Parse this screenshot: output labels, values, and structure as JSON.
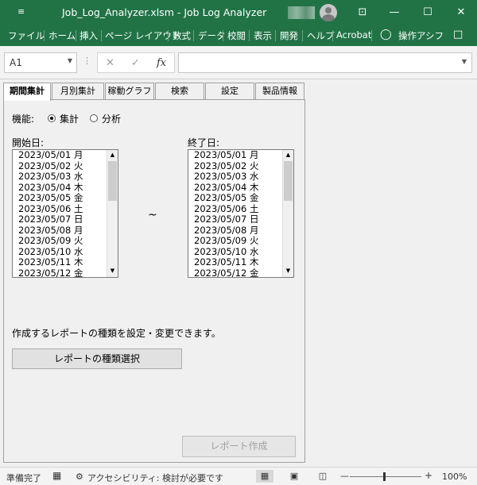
{
  "titlebar": {
    "qat_icon": "customize-qat-icon",
    "title": "Job_Log_Analyzer.xlsm  -  Job Log Analyzer",
    "minimize": "—",
    "maximize": "☐",
    "close": "✕",
    "ribbon_display": "⊡"
  },
  "ribbon": {
    "tabs": [
      "ファイル",
      "ホーム",
      "挿入",
      "ページ レイアウト",
      "数式",
      "データ",
      "校閲",
      "表示",
      "開発",
      "ヘルプ",
      "Acrobat"
    ],
    "tell_me": "操作アシフ"
  },
  "formula_bar": {
    "name_box": "A1",
    "dots": "⋮",
    "cancel": "✕",
    "enter": "✓",
    "fx": "fx",
    "formula": ""
  },
  "form": {
    "tabs": [
      "期間集計",
      "月別集計",
      "稼動グラフ",
      "検索",
      "設定",
      "製品情報"
    ],
    "active_tab_index": 0,
    "function_label": "機能:",
    "mode_options": [
      "集計",
      "分析"
    ],
    "selected_mode": "集計",
    "start_label": "開始日:",
    "end_label": "終了日:",
    "tilde": "~",
    "dates": [
      "2023/05/01 月",
      "2023/05/02 火",
      "2023/05/03 水",
      "2023/05/04 木",
      "2023/05/05 金",
      "2023/05/06 土",
      "2023/05/07 日",
      "2023/05/08 月",
      "2023/05/09 火",
      "2023/05/10 水",
      "2023/05/11 木",
      "2023/05/12 金"
    ],
    "report_hint": "作成するレポートの種類を設定・変更できます。",
    "report_type_button": "レポートの種類選択",
    "create_report_button": "レポート作成"
  },
  "status": {
    "ready": "準備完了",
    "accessibility": "アクセシビリティ: 検討が必要です",
    "zoom_minus": "—",
    "zoom_plus": "+",
    "zoom": "100%"
  }
}
